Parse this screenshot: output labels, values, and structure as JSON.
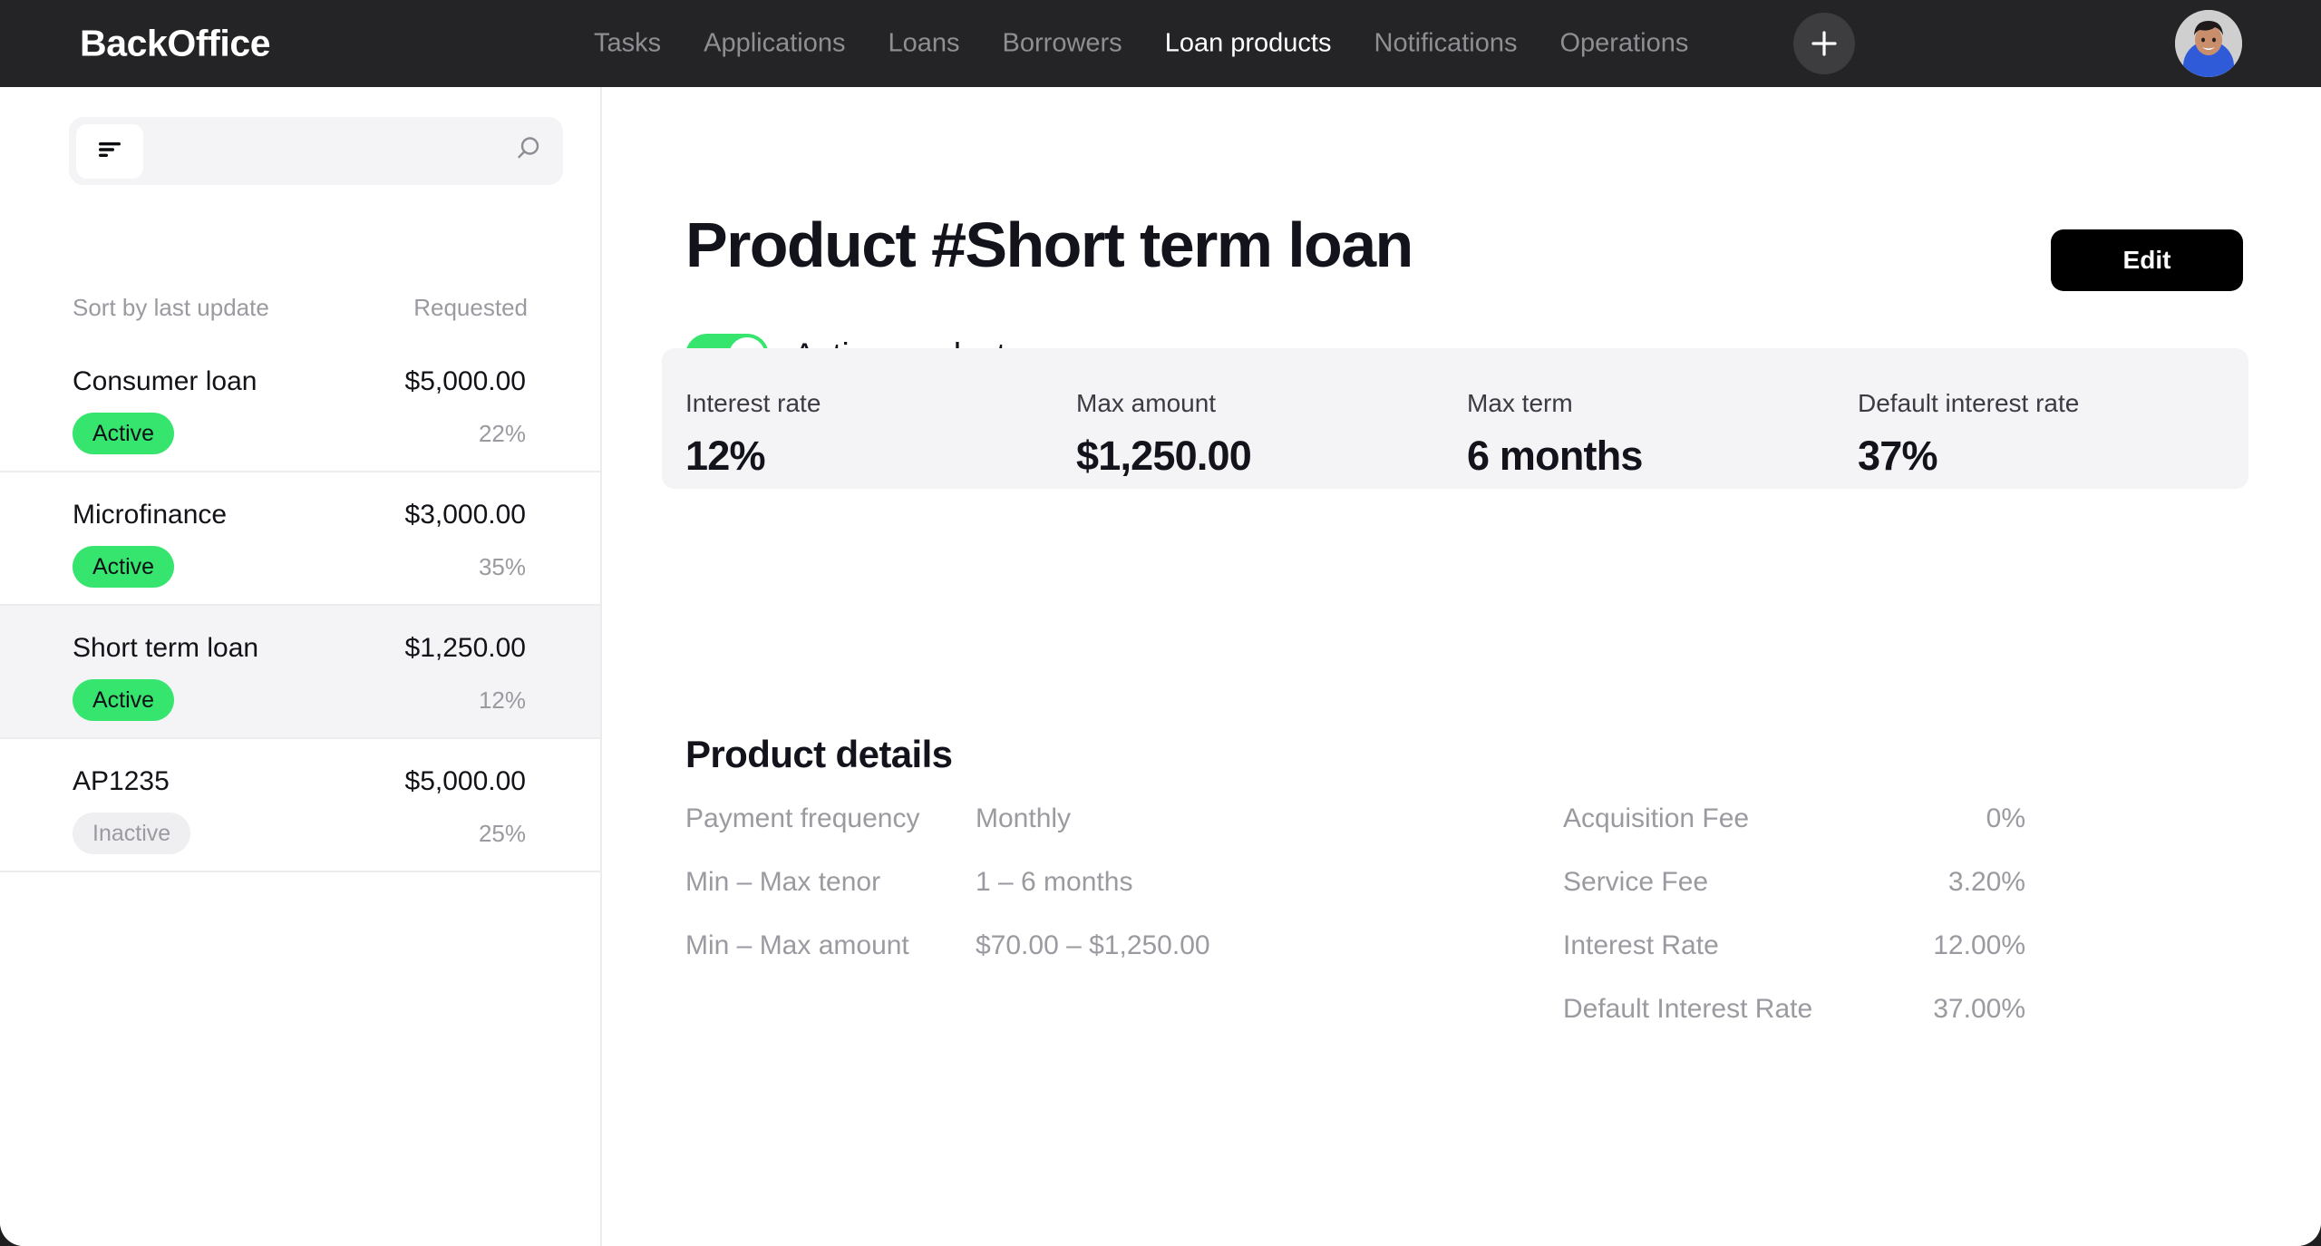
{
  "topbar": {
    "logo": "BackOffice",
    "nav": [
      {
        "label": "Tasks",
        "active": false
      },
      {
        "label": "Applications",
        "active": false
      },
      {
        "label": "Loans",
        "active": false
      },
      {
        "label": "Borrowers",
        "active": false
      },
      {
        "label": "Loan products",
        "active": true
      },
      {
        "label": "Notifications",
        "active": false
      },
      {
        "label": "Operations",
        "active": false
      }
    ],
    "add_icon": "plus-icon",
    "avatar_icon": "user-avatar"
  },
  "sidebar": {
    "filter_icon": "filter-icon",
    "search_icon": "search-icon",
    "search_value": "",
    "sort_label": "Sort by last update",
    "sort_right": "Requested",
    "items": [
      {
        "name": "Consumer loan",
        "amount": "$5,000.00",
        "status": "Active",
        "percent": "22%",
        "selected": false
      },
      {
        "name": "Microfinance",
        "amount": "$3,000.00",
        "status": "Active",
        "percent": "35%",
        "selected": false
      },
      {
        "name": "Short term loan",
        "amount": "$1,250.00",
        "status": "Active",
        "percent": "12%",
        "selected": true
      },
      {
        "name": "AP1235",
        "amount": "$5,000.00",
        "status": "Inactive",
        "percent": "25%",
        "selected": false
      }
    ]
  },
  "main": {
    "title": "Product #Short term loan",
    "edit_label": "Edit",
    "toggle_label": "Active product",
    "toggle_on": true,
    "stats": [
      {
        "label": "Interest rate",
        "value": "12%"
      },
      {
        "label": "Max amount",
        "value": "$1,250.00"
      },
      {
        "label": "Max term",
        "value": "6 months"
      },
      {
        "label": "Default interest rate",
        "value": "37%"
      }
    ],
    "details_title": "Product details",
    "details_left": [
      {
        "label": "Payment frequency",
        "value": "Monthly"
      },
      {
        "label": "Min – Max tenor",
        "value": "1 – 6 months"
      },
      {
        "label": "Min – Max amount",
        "value": "$70.00 – $1,250.00"
      }
    ],
    "details_right": [
      {
        "label": "Acquisition Fee",
        "value": "0%"
      },
      {
        "label": "Service Fee",
        "value": "3.20%"
      },
      {
        "label": "Interest Rate",
        "value": "12.00%"
      },
      {
        "label": "Default Interest Rate",
        "value": "37.00%"
      }
    ]
  },
  "colors": {
    "topbar_bg": "#242426",
    "accent_green": "#36e56e",
    "card_bg": "#f4f4f6",
    "selected_row": "#f4f4f7",
    "muted_text": "#9a9aa0",
    "dark_text": "#13131c"
  }
}
